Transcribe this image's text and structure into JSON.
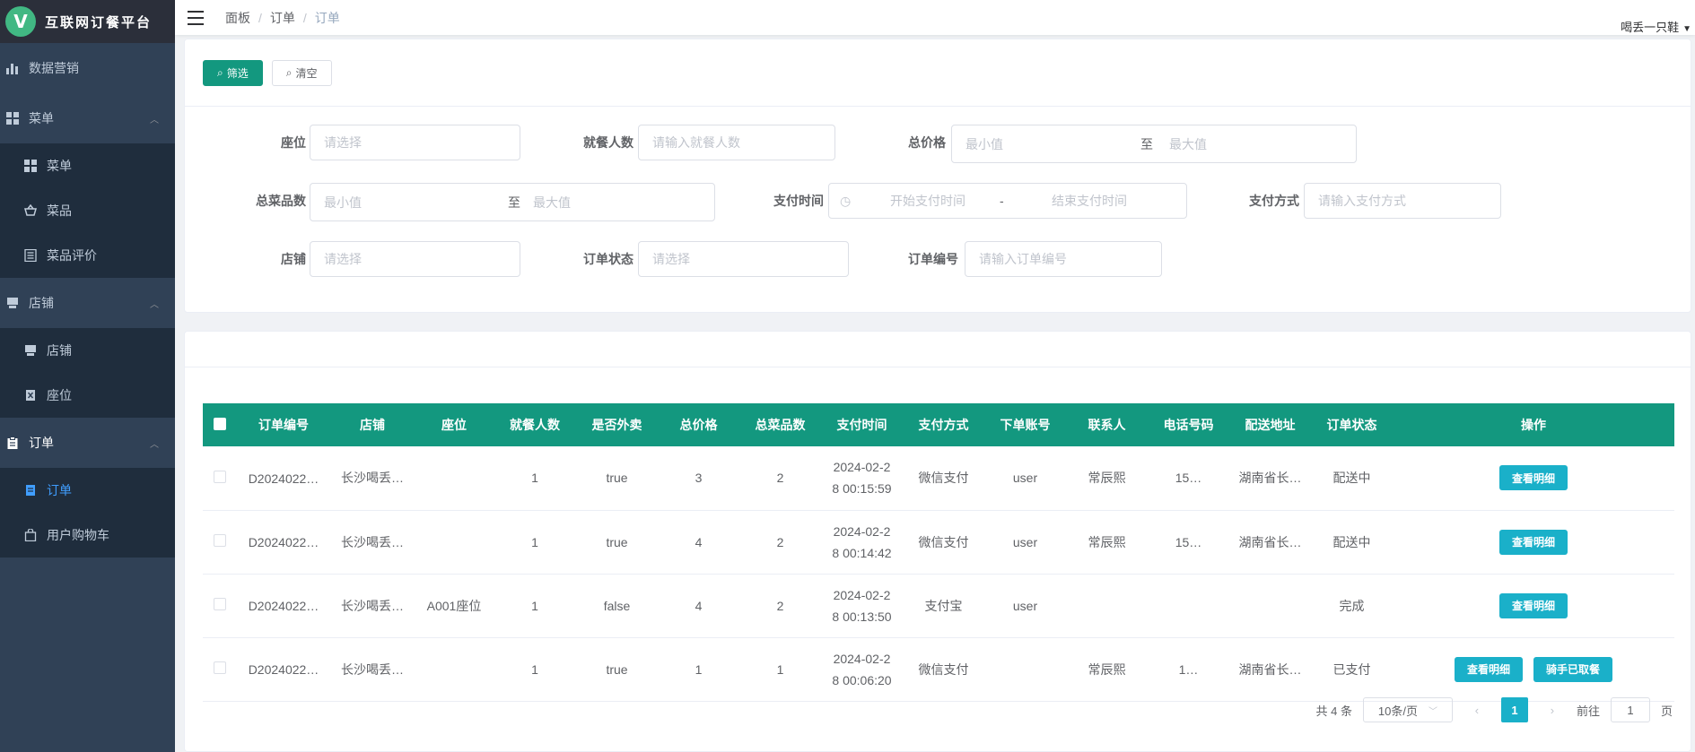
{
  "app": {
    "title": "互联网订餐平台",
    "logo_letter": "V"
  },
  "sidebar": {
    "items": [
      {
        "label": "数据营销",
        "icon": "bar-chart-icon"
      },
      {
        "label": "菜单",
        "icon": "grid-icon",
        "children": [
          {
            "label": "菜单",
            "icon": "grid-icon"
          },
          {
            "label": "菜品",
            "icon": "basket-icon"
          },
          {
            "label": "菜品评价",
            "icon": "list-icon"
          }
        ]
      },
      {
        "label": "店铺",
        "icon": "store-icon",
        "children": [
          {
            "label": "店铺",
            "icon": "store-icon"
          },
          {
            "label": "座位",
            "icon": "seat-icon"
          }
        ]
      },
      {
        "label": "订单",
        "icon": "clipboard-icon",
        "children": [
          {
            "label": "订单",
            "icon": "document-icon",
            "active": true
          },
          {
            "label": "用户购物车",
            "icon": "bag-icon"
          }
        ]
      }
    ]
  },
  "navbar": {
    "breadcrumb": [
      "面板",
      "订单",
      "订单"
    ],
    "user": "喝丢一只鞋"
  },
  "filter": {
    "filter_btn": "筛选",
    "clear_btn": "清空",
    "fields": {
      "seat": {
        "label": "座位",
        "placeholder": "请选择"
      },
      "diners": {
        "label": "就餐人数",
        "placeholder": "请输入就餐人数"
      },
      "total_price": {
        "label": "总价格",
        "min": "最小值",
        "to": "至",
        "max": "最大值"
      },
      "total_items": {
        "label": "总菜品数",
        "min": "最小值",
        "to": "至",
        "max": "最大值"
      },
      "pay_time": {
        "label": "支付时间",
        "start": "开始支付时间",
        "dash": "-",
        "end": "结束支付时间"
      },
      "pay_method": {
        "label": "支付方式",
        "placeholder": "请输入支付方式"
      },
      "store": {
        "label": "店铺",
        "placeholder": "请选择"
      },
      "order_status": {
        "label": "订单状态",
        "placeholder": "请选择"
      },
      "order_no": {
        "label": "订单编号",
        "placeholder": "请输入订单编号"
      }
    }
  },
  "table": {
    "headers": [
      "订单编号",
      "店铺",
      "座位",
      "就餐人数",
      "是否外卖",
      "总价格",
      "总菜品数",
      "支付时间",
      "支付方式",
      "下单账号",
      "联系人",
      "电话号码",
      "配送地址",
      "订单状态",
      "操作"
    ],
    "rows": [
      {
        "order_no": "D2024022…",
        "store": "长沙喝丢…",
        "seat": "",
        "diners": "1",
        "takeout": "true",
        "price": "3",
        "items": "2",
        "time1": "2024-02-2",
        "time2": "8 00:15:59",
        "pay": "微信支付",
        "account": "user",
        "contact": "常辰熙",
        "phone": "15…",
        "address": "湖南省长…",
        "status": "配送中",
        "actions": [
          "查看明细"
        ]
      },
      {
        "order_no": "D2024022…",
        "store": "长沙喝丢…",
        "seat": "",
        "diners": "1",
        "takeout": "true",
        "price": "4",
        "items": "2",
        "time1": "2024-02-2",
        "time2": "8 00:14:42",
        "pay": "微信支付",
        "account": "user",
        "contact": "常辰熙",
        "phone": "15…",
        "address": "湖南省长…",
        "status": "配送中",
        "actions": [
          "查看明细"
        ]
      },
      {
        "order_no": "D2024022…",
        "store": "长沙喝丢…",
        "seat": "A001座位",
        "diners": "1",
        "takeout": "false",
        "price": "4",
        "items": "2",
        "time1": "2024-02-2",
        "time2": "8 00:13:50",
        "pay": "支付宝",
        "account": "user",
        "contact": "",
        "phone": "",
        "address": "",
        "status": "完成",
        "actions": [
          "查看明细"
        ]
      },
      {
        "order_no": "D2024022…",
        "store": "长沙喝丢…",
        "seat": "",
        "diners": "1",
        "takeout": "true",
        "price": "1",
        "items": "1",
        "time1": "2024-02-2",
        "time2": "8 00:06:20",
        "pay": "微信支付",
        "account": "",
        "contact": "常辰熙",
        "phone": "1…",
        "address": "湖南省长…",
        "status": "已支付",
        "actions": [
          "查看明细",
          "骑手已取餐"
        ]
      }
    ]
  },
  "pagination": {
    "total": "共 4 条",
    "page_size": "10条/页",
    "current": "1",
    "goto_prefix": "前往",
    "goto_value": "1",
    "goto_suffix": "页"
  },
  "colors": {
    "sidebar_bg": "#304156",
    "primary": "#13987f",
    "accent": "#1ab0c9",
    "active_menu": "#409eff"
  }
}
